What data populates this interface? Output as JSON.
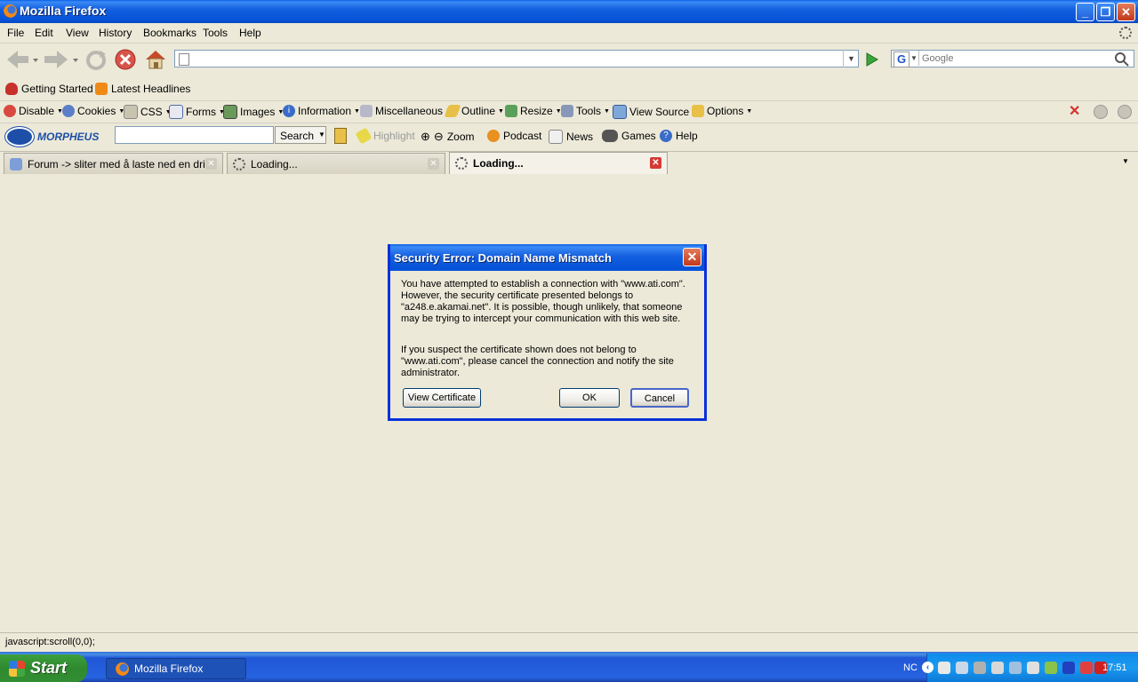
{
  "window": {
    "title": "Mozilla Firefox"
  },
  "menu": {
    "items": [
      "File",
      "Edit",
      "View",
      "History",
      "Bookmarks",
      "Tools",
      "Help"
    ]
  },
  "nav": {
    "url": "",
    "search_placeholder": "Google"
  },
  "bookmarks": [
    "Getting Started",
    "Latest Headlines"
  ],
  "webdev": {
    "items": [
      "Disable",
      "Cookies",
      "CSS",
      "Forms",
      "Images",
      "Information",
      "Miscellaneous",
      "Outline",
      "Resize",
      "Tools",
      "View Source",
      "Options"
    ]
  },
  "morpheus": {
    "brand": "MORPHEUS",
    "search_button": "Search",
    "highlight": "Highlight",
    "zoom": "Zoom",
    "podcast": "Podcast",
    "news": "News",
    "games": "Games",
    "help": "Help"
  },
  "tabs": [
    {
      "label": "Forum -> sliter med å laste ned en dri...",
      "selected": false
    },
    {
      "label": "Loading...",
      "selected": false
    },
    {
      "label": "Loading...",
      "selected": true
    }
  ],
  "dialog": {
    "title": "Security Error: Domain Name Mismatch",
    "para1": "You have attempted to establish a connection with \"www.ati.com\". However, the security certificate presented belongs to \"a248.e.akamai.net\". It is possible, though unlikely, that someone may be trying to intercept your communication with this web site.",
    "para2": "If you suspect the certificate shown does not belong to \"www.ati.com\", please cancel the connection and notify the site administrator.",
    "view_cert": "View Certificate",
    "ok": "OK",
    "cancel": "Cancel"
  },
  "status": {
    "text": "javascript:scroll(0,0);"
  },
  "taskbar": {
    "start": "Start",
    "window_item": "Mozilla Firefox",
    "lang": "NC",
    "clock": "17:51"
  },
  "colors": {
    "xp_blue": "#0653D8",
    "accent_red": "#D63A34"
  }
}
